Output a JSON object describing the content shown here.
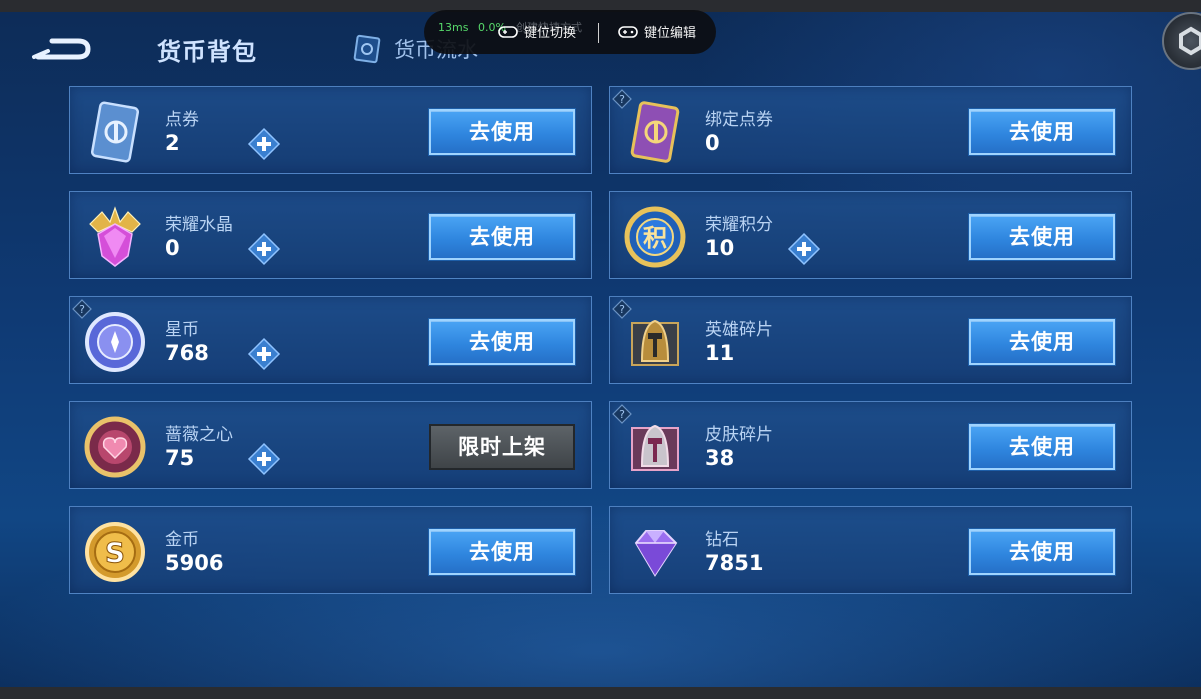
{
  "header": {
    "active_tab": "货币背包",
    "flow_tab": "货币流水"
  },
  "overlay": {
    "latency": "13ms",
    "loss": "0.0%",
    "ghost_text": "创建快捷方式",
    "switch_label": "键位切换",
    "edit_label": "键位编辑"
  },
  "colors": {
    "use_button": "#2f86df",
    "card_bg": "#1e4e8c",
    "limited_button": "#4a4f53"
  },
  "cards": [
    {
      "name": "点券",
      "value": "2",
      "icon": "ticket-blue-icon",
      "button": "去使用",
      "plus": true,
      "help": false
    },
    {
      "name": "绑定点券",
      "value": "0",
      "icon": "ticket-purple-icon",
      "button": "去使用",
      "plus": false,
      "help": true
    },
    {
      "name": "荣耀水晶",
      "value": "0",
      "icon": "glory-crystal-icon",
      "button": "去使用",
      "plus": true,
      "help": false
    },
    {
      "name": "荣耀积分",
      "value": "10",
      "icon": "glory-points-icon",
      "button": "去使用",
      "plus": true,
      "help": false
    },
    {
      "name": "星币",
      "value": "768",
      "icon": "star-coin-icon",
      "button": "去使用",
      "plus": true,
      "help": true
    },
    {
      "name": "英雄碎片",
      "value": "11",
      "icon": "hero-fragment-icon",
      "button": "去使用",
      "plus": false,
      "help": true
    },
    {
      "name": "蔷薇之心",
      "value": "75",
      "icon": "rose-heart-icon",
      "button": "限时上架",
      "plus": true,
      "help": false
    },
    {
      "name": "皮肤碎片",
      "value": "38",
      "icon": "skin-fragment-icon",
      "button": "去使用",
      "plus": false,
      "help": true
    },
    {
      "name": "金币",
      "value": "5906",
      "icon": "gold-coin-icon",
      "button": "去使用",
      "plus": false,
      "help": false
    },
    {
      "name": "钻石",
      "value": "7851",
      "icon": "diamond-icon",
      "button": "去使用",
      "plus": false,
      "help": false
    }
  ]
}
